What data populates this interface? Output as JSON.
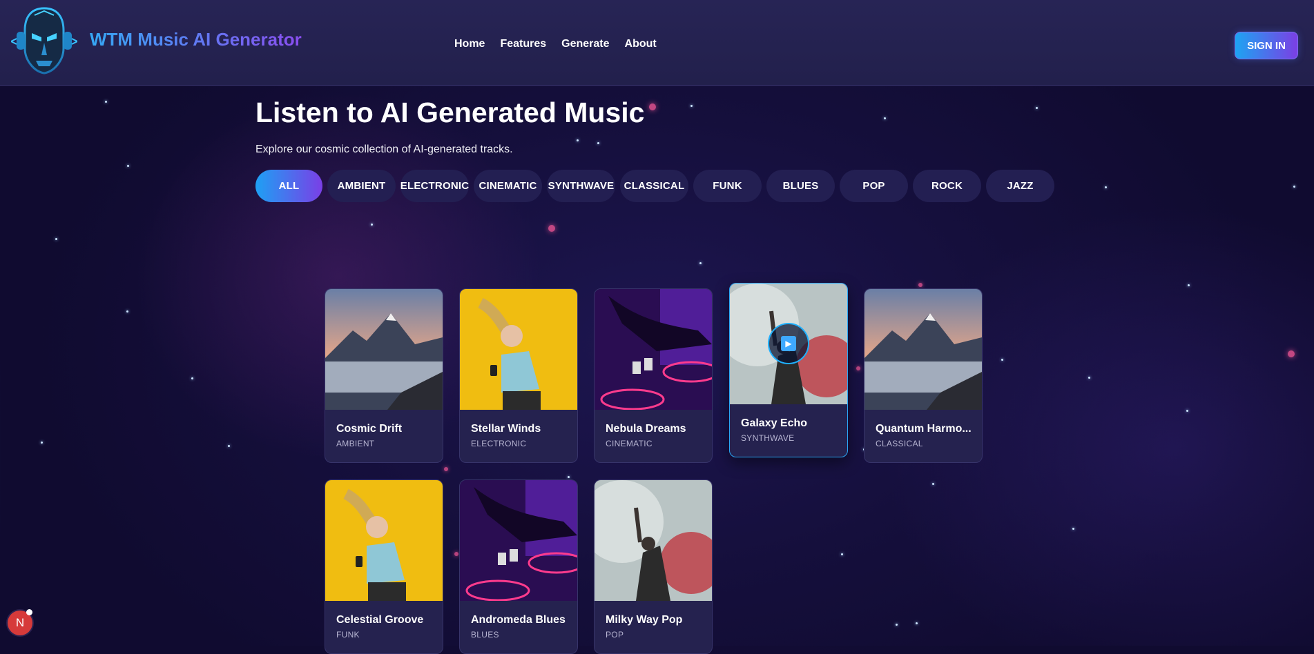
{
  "header": {
    "brand": "WTM Music AI Generator",
    "nav": [
      "Home",
      "Features",
      "Generate",
      "About"
    ],
    "signin_label": "SIGN IN"
  },
  "main": {
    "title": "Listen to AI Generated Music",
    "subtitle": "Explore our cosmic collection of AI-generated tracks.",
    "filters": [
      {
        "label": "ALL",
        "active": true
      },
      {
        "label": "AMBIENT"
      },
      {
        "label": "ELECTRONIC"
      },
      {
        "label": "CINEMATIC"
      },
      {
        "label": "SYNTHWAVE"
      },
      {
        "label": "CLASSICAL"
      },
      {
        "label": "FUNK"
      },
      {
        "label": "BLUES"
      },
      {
        "label": "POP"
      },
      {
        "label": "ROCK"
      },
      {
        "label": "JAZZ"
      }
    ],
    "tracks": [
      {
        "title": "Cosmic Drift",
        "genre": "AMBIENT",
        "art": "mountains"
      },
      {
        "title": "Stellar Winds",
        "genre": "ELECTRONIC",
        "art": "dancer-yellow"
      },
      {
        "title": "Nebula Dreams",
        "genre": "CINEMATIC",
        "art": "dj-purple"
      },
      {
        "title": "Galaxy Echo",
        "genre": "SYNTHWAVE",
        "art": "concert-smoke",
        "hovered": true
      },
      {
        "title": "Quantum Harmo...",
        "genre": "CLASSICAL",
        "art": "mountains"
      },
      {
        "title": "Celestial Groove",
        "genre": "FUNK",
        "art": "dancer-yellow"
      },
      {
        "title": "Andromeda Blues",
        "genre": "BLUES",
        "art": "dj-purple"
      },
      {
        "title": "Milky Way Pop",
        "genre": "POP",
        "art": "concert-smoke"
      }
    ]
  },
  "dev_badge": "N",
  "colors": {
    "accent_start": "#1ea0f4",
    "accent_end": "#7a3fe6",
    "card_bg": "#25224f"
  }
}
